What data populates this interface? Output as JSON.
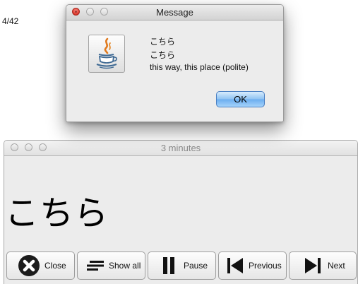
{
  "main_window": {
    "title": "3 minutes",
    "counter": "4/42",
    "word": "こちら",
    "buttons": {
      "close": "Close",
      "show_all": "Show all",
      "pause": "Pause",
      "previous": "Previous",
      "next": "Next"
    }
  },
  "dialog": {
    "title": "Message",
    "lines": [
      "こちら",
      "こちら",
      "this way, this place (polite)"
    ],
    "ok_label": "OK",
    "icon": "java-coffee-cup-icon"
  },
  "colors": {
    "window_bg": "#ececec",
    "ok_accent": "#6aadef",
    "close_dot": "#d8362a"
  }
}
